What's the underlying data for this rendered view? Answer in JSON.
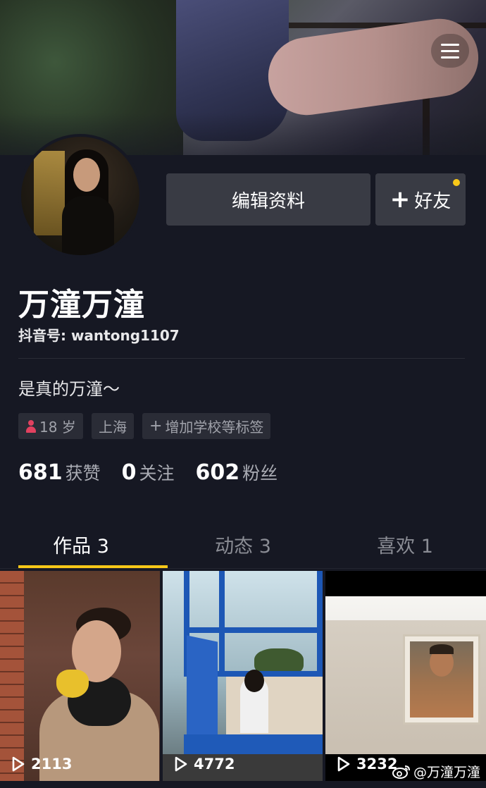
{
  "header": {
    "menu_icon": "hamburger-menu-icon"
  },
  "profile": {
    "edit_button": "编辑资料",
    "friend_button": "好友",
    "friend_button_plus": "+",
    "name": "万潼万潼",
    "douyin_id": "抖音号: wantong1107",
    "bio": "是真的万潼～"
  },
  "tags": {
    "age": "18 岁",
    "city": "上海",
    "add": "增加学校等标签",
    "add_plus": "+"
  },
  "stats": {
    "likes_num": "681",
    "likes_label": "获赞",
    "following_num": "0",
    "following_label": "关注",
    "followers_num": "602",
    "followers_label": "粉丝"
  },
  "tabs": [
    {
      "label": "作品 3"
    },
    {
      "label": "动态 3"
    },
    {
      "label": "喜欢 1"
    }
  ],
  "videos": [
    {
      "plays": "2113"
    },
    {
      "plays": "4772"
    },
    {
      "plays": "3232"
    }
  ],
  "watermark": "@万潼万潼",
  "colors": {
    "background": "#161823",
    "accent": "#f8c818",
    "button": "#393b44",
    "age_icon": "#e2415f"
  }
}
